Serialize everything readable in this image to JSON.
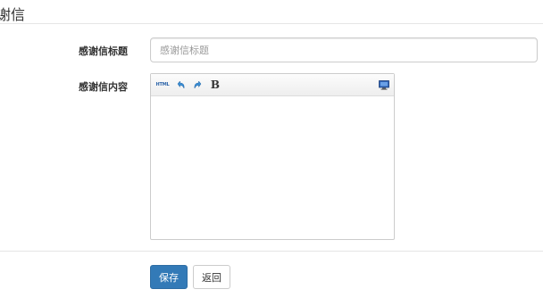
{
  "header": {
    "title": "谢信"
  },
  "form": {
    "title_label": "感谢信标题",
    "title_placeholder": "感谢信标题",
    "title_value": "",
    "content_label": "感谢信内容",
    "content_value": ""
  },
  "editor": {
    "toolbar": {
      "html_label": "HTML",
      "bold_label": "B",
      "icons": [
        "html-icon",
        "undo-icon",
        "redo-icon",
        "bold-icon",
        "fullscreen-icon"
      ]
    }
  },
  "actions": {
    "save_label": "保存",
    "back_label": "返回"
  },
  "colors": {
    "primary": "#337ab7",
    "border": "#cccccc"
  }
}
